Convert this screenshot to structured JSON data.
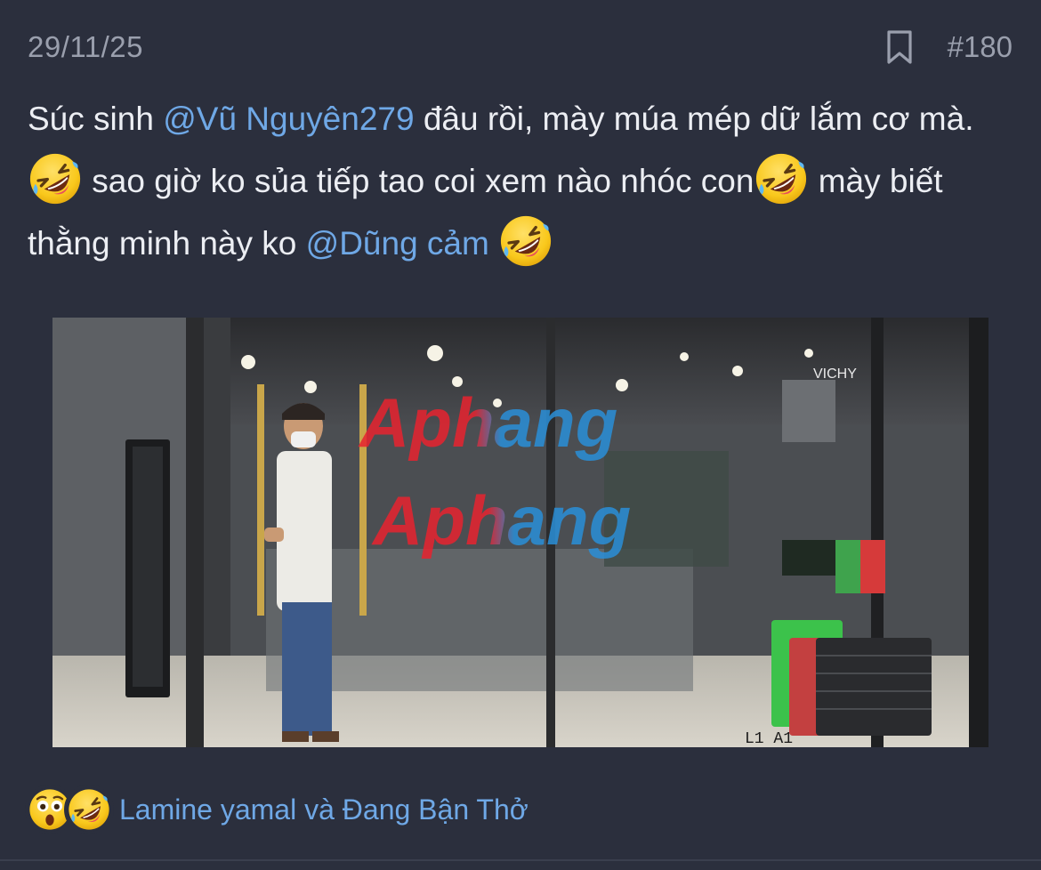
{
  "post": {
    "date": "29/11/25",
    "number": "#180",
    "bookmark_icon": "bookmark-icon",
    "body": {
      "t1": "Súc sinh ",
      "mention1": "@Vũ Nguyên279",
      "t2": " đâu rồi, mày múa mép dữ lắm cơ mà.",
      "t3": " sao giờ ko sủa tiếp tao coi xem nào nhóc con",
      "t4": " mày biết thằng minh này ko ",
      "mention2": "@Dũng cảm",
      "emoji": "rolling-on-floor-laughing"
    },
    "image": {
      "watermark_top": "Aphang",
      "watermark_bottom": "Aphang",
      "store_sign": "VICHY",
      "camera_label": "L1 A1"
    },
    "reactions": {
      "emojis": [
        "astonished-face",
        "rolling-on-floor-laughing"
      ],
      "text": "Lamine yamal và Đang Bận Thở"
    }
  },
  "colors": {
    "background": "#2b2f3d",
    "text": "#eceef3",
    "muted": "#9a9fad",
    "link": "#6fa8e6"
  }
}
